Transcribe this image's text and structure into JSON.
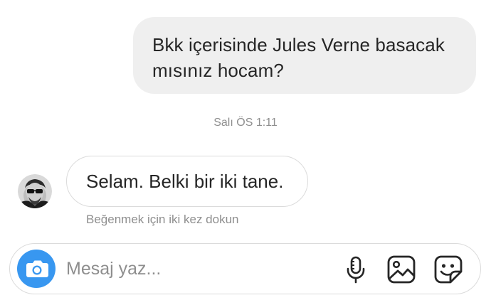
{
  "messages": {
    "outgoing": {
      "text": "Bkk içerisinde Jules Verne basacak mısınız hocam?"
    },
    "timestamp": "Salı ÖS 1:11",
    "incoming": {
      "text": "Selam. Belki bir iki tane.",
      "hint": "Beğenmek için iki kez dokun"
    }
  },
  "composer": {
    "placeholder": "Mesaj yaz...",
    "camera_icon": "camera-icon",
    "mic_icon": "microphone-icon",
    "gallery_icon": "image-icon",
    "sticker_icon": "sticker-icon"
  },
  "colors": {
    "accent": "#3897f0",
    "bubble_out": "#efefef",
    "border": "#dbdbdb",
    "muted_text": "#8e8e8e",
    "text": "#262626"
  }
}
